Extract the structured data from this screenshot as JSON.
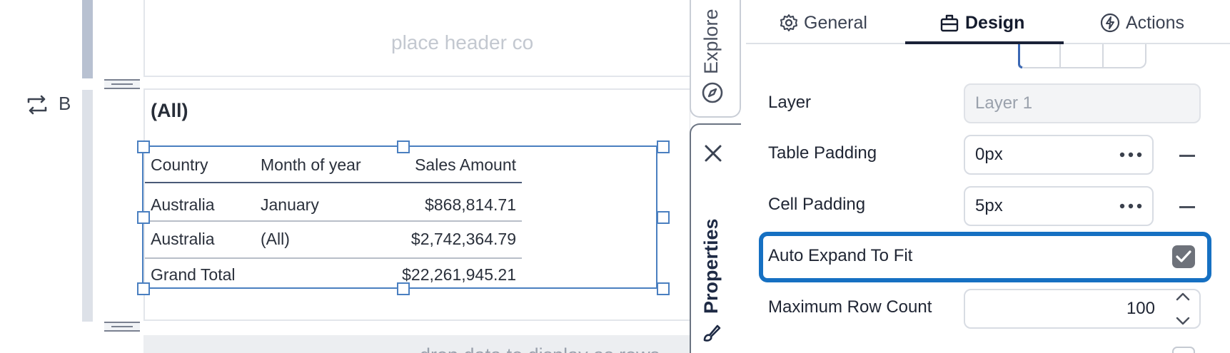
{
  "canvas": {
    "header_placeholder": "place header co",
    "band_letter": "B",
    "filter_label": "(All)",
    "table": {
      "columns": [
        "Country",
        "Month of year",
        "Sales Amount"
      ],
      "rows": [
        [
          "Australia",
          "January",
          "$868,814.71"
        ],
        [
          "Australia",
          "(All)",
          "$2,742,364.79"
        ]
      ],
      "total": [
        "Grand Total",
        "",
        "$22,261,945.21"
      ]
    },
    "rows_placeholder": "drop data to display as rows"
  },
  "side_tabs": {
    "explore": "Explore",
    "properties": "Properties"
  },
  "panel": {
    "tabs": [
      {
        "label": "General",
        "icon": "gear-icon"
      },
      {
        "label": "Design",
        "icon": "design-icon"
      },
      {
        "label": "Actions",
        "icon": "bolt-icon"
      }
    ],
    "active_tab": "Design",
    "properties": {
      "layer": {
        "label": "Layer",
        "placeholder": "Layer 1"
      },
      "table_padding": {
        "label": "Table Padding",
        "value": "0px"
      },
      "cell_padding": {
        "label": "Cell Padding",
        "value": "5px"
      },
      "auto_expand": {
        "label": "Auto Expand To Fit",
        "checked": true
      },
      "max_row_count": {
        "label": "Maximum Row Count",
        "value": "100"
      }
    },
    "colors": {
      "highlight": "#1670c2",
      "selection": "#4a7fc0",
      "active_tab_underline": "#1a2238"
    }
  }
}
